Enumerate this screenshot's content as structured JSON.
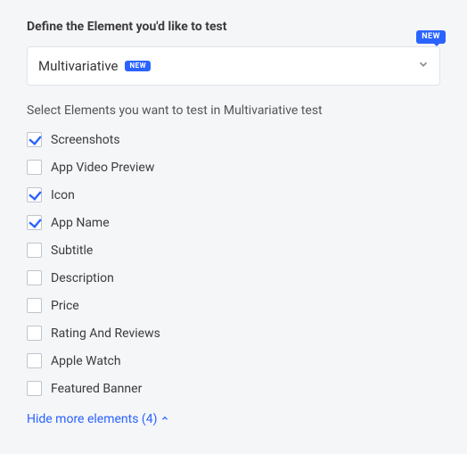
{
  "section_title": "Define the Element you'd like to test",
  "new_badge_text": "NEW",
  "select": {
    "value": "Multivariative",
    "new_badge_text": "NEW"
  },
  "subheading": "Select Elements you want to test in Multivariative test",
  "elements": [
    {
      "label": "Screenshots",
      "checked": true
    },
    {
      "label": "App Video Preview",
      "checked": false
    },
    {
      "label": "Icon",
      "checked": true
    },
    {
      "label": "App Name",
      "checked": true
    },
    {
      "label": "Subtitle",
      "checked": false
    },
    {
      "label": "Description",
      "checked": false
    },
    {
      "label": "Price",
      "checked": false
    },
    {
      "label": "Rating And Reviews",
      "checked": false
    },
    {
      "label": "Apple Watch",
      "checked": false
    },
    {
      "label": "Featured Banner",
      "checked": false
    }
  ],
  "toggle_link": "Hide more elements (4)"
}
